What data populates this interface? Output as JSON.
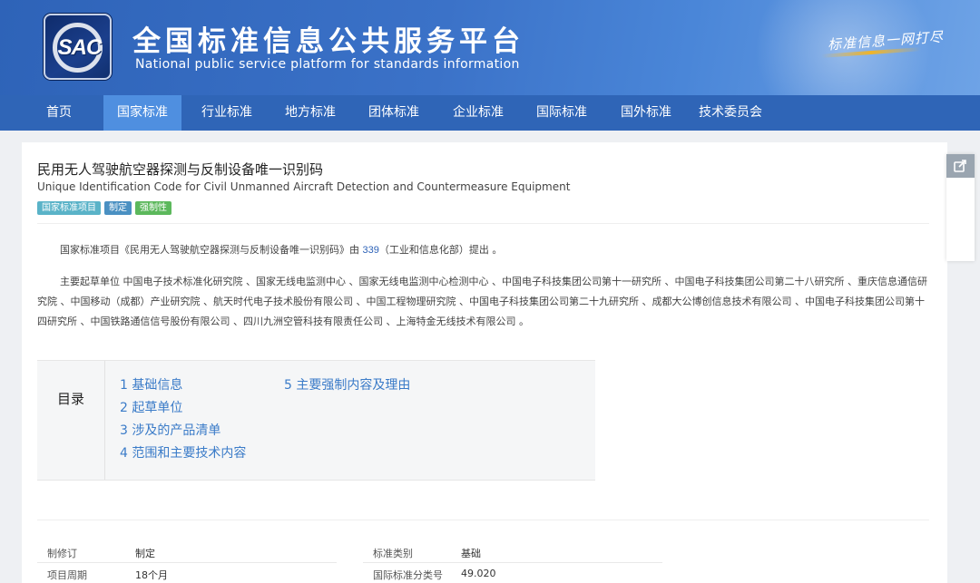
{
  "header": {
    "logo_text": "SAC",
    "title_cn": "全国标准信息公共服务平台",
    "title_en": "National public service platform  for standards information",
    "slogan": "标准信息一网打尽"
  },
  "nav": {
    "items": [
      {
        "label": "首页",
        "active": false
      },
      {
        "label": "国家标准",
        "active": true
      },
      {
        "label": "行业标准",
        "active": false
      },
      {
        "label": "地方标准",
        "active": false
      },
      {
        "label": "团体标准",
        "active": false
      },
      {
        "label": "企业标准",
        "active": false
      },
      {
        "label": "国际标准",
        "active": false
      },
      {
        "label": "国外标准",
        "active": false
      },
      {
        "label": "技术委员会",
        "active": false
      }
    ]
  },
  "standard": {
    "title_cn": "民用无人驾驶航空器探测与反制设备唯一识别码",
    "title_en": "Unique Identification Code for Civil Unmanned Aircraft Detection and Countermeasure Equipment",
    "tags": [
      "国家标准项目",
      "制定",
      "强制性"
    ],
    "proposal_pre": "国家标准项目《民用无人驾驶航空器探测与反制设备唯一识别码》由",
    "proposal_num": "339",
    "proposal_post": "（工业和信息化部）提出 。",
    "drafters": "主要起草单位 中国电子技术标准化研究院 、国家无线电监测中心 、国家无线电监测中心检测中心 、中国电子科技集团公司第十一研究所 、中国电子科技集团公司第二十八研究所 、重庆信息通信研究院 、中国移动（成都）产业研究院 、航天时代电子技术股份有限公司 、中国工程物理研究院 、中国电子科技集团公司第二十九研究所 、成都大公博创信息技术有限公司 、中国电子科技集团公司第十四研究所 、中国铁路通信信号股份有限公司 、四川九洲空管科技有限责任公司 、上海特金无线技术有限公司 。"
  },
  "toc": {
    "label": "目录",
    "items": [
      "1  基础信息",
      "2  起草单位",
      "3  涉及的产品清单",
      "4  范围和主要技术内容",
      "5  主要强制内容及理由"
    ]
  },
  "info": {
    "rows": [
      {
        "k1": "制修订",
        "v1": "制定",
        "k2": "标准类别",
        "v2": "基础"
      },
      {
        "k1": "项目周期",
        "v1": "18个月",
        "k2": "国际标准分类号",
        "v2": "49.020"
      }
    ]
  },
  "colors": {
    "header_blue": "#2e63b8",
    "nav_active": "#4f8fe0",
    "link_blue": "#3a7bc8"
  },
  "icons": {
    "share": "share-icon"
  }
}
